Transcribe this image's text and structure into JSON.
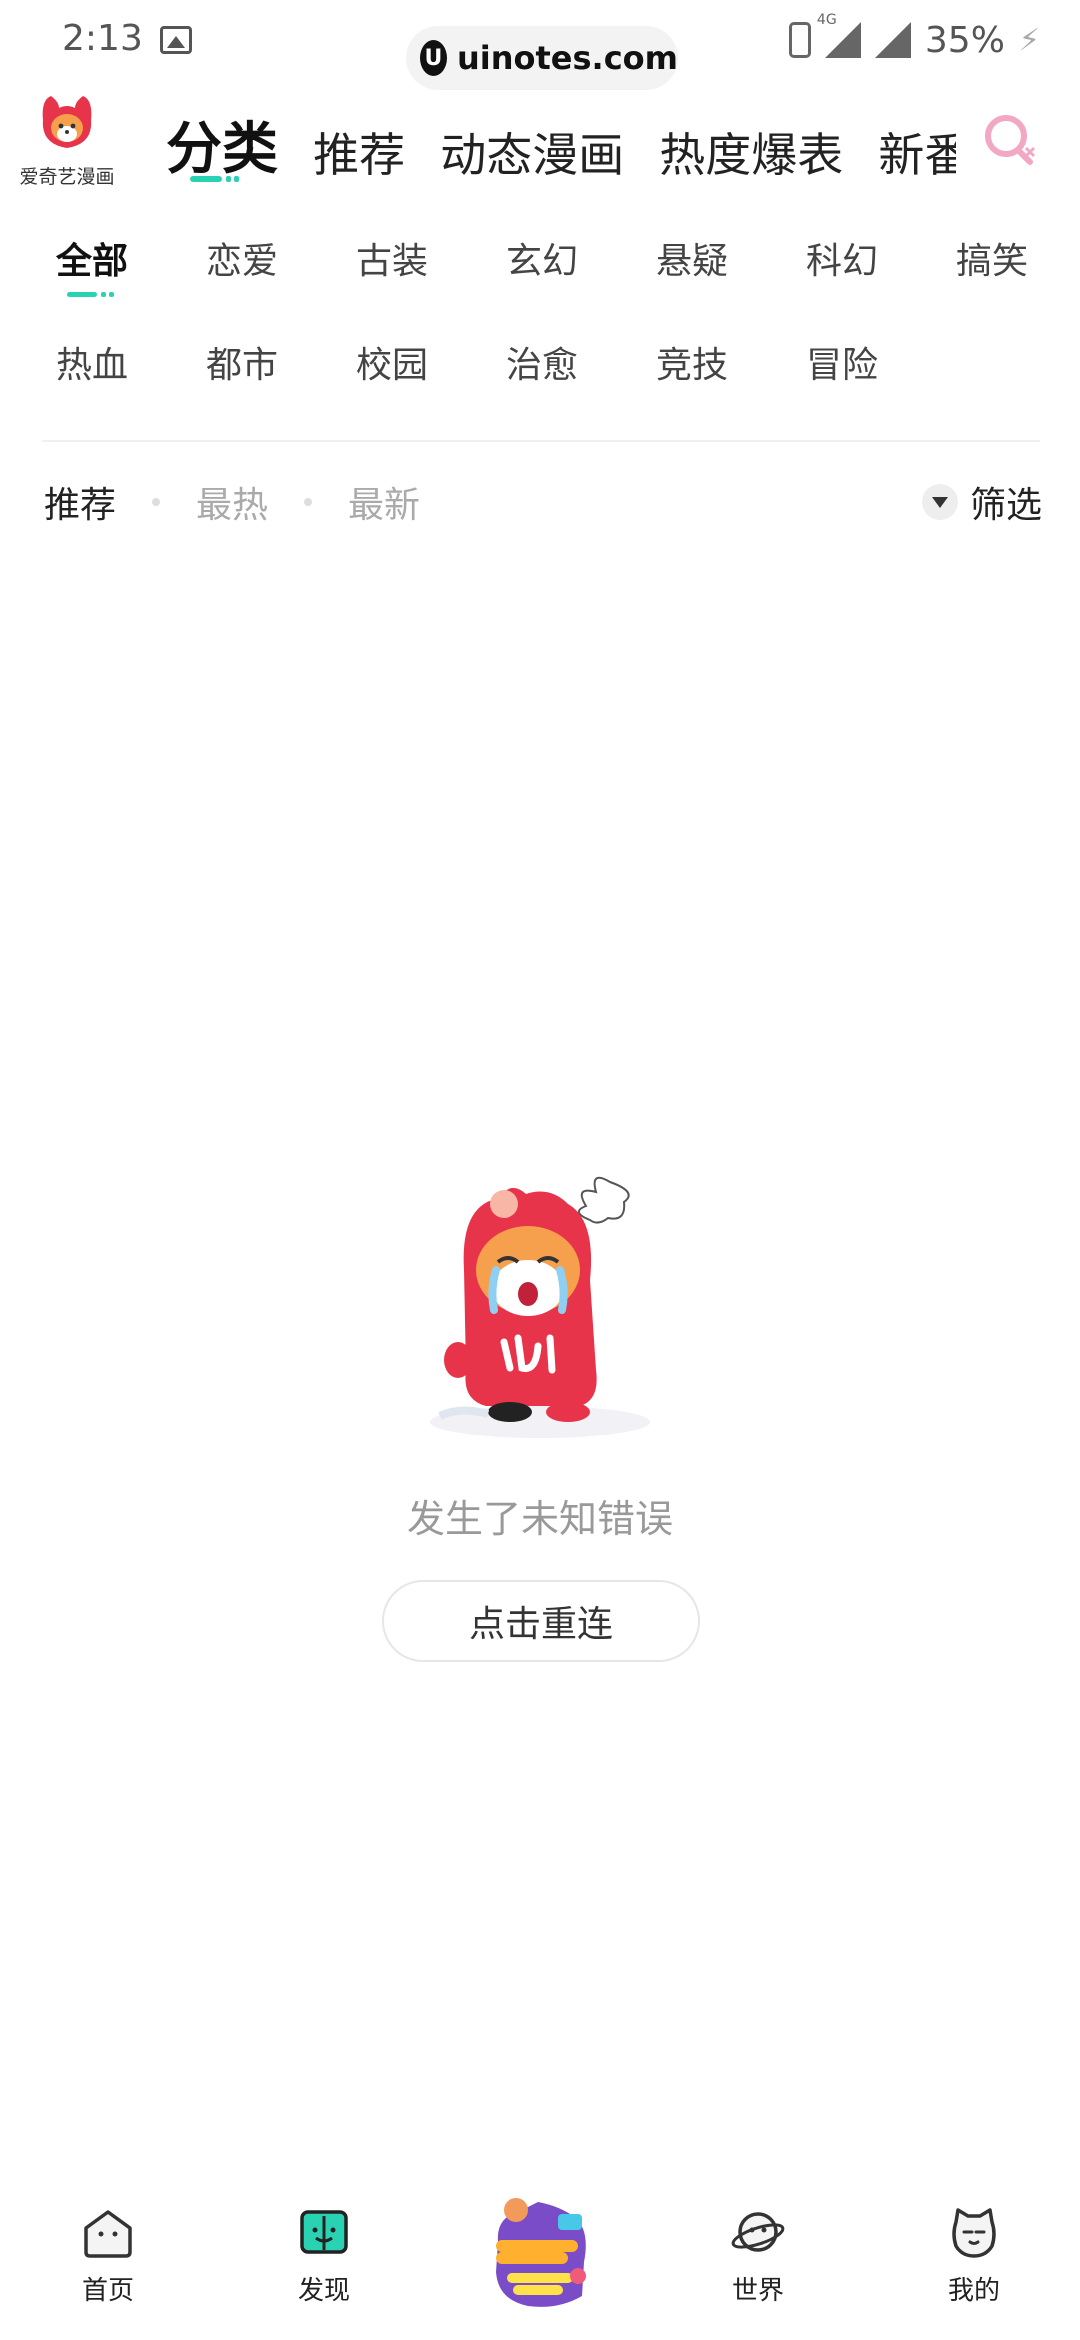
{
  "status_bar": {
    "time": "2:13",
    "watermark": "uinotes.com",
    "network": "4G",
    "battery": "35%"
  },
  "brand": {
    "label": "爱奇艺漫画"
  },
  "top_tabs": [
    "分类",
    "推荐",
    "动态漫画",
    "热度爆表",
    "新番大"
  ],
  "active_top_tab": "分类",
  "categories": {
    "row1": [
      "全部",
      "恋爱",
      "古装",
      "玄幻",
      "悬疑",
      "科幻",
      "搞笑"
    ],
    "row2": [
      "热血",
      "都市",
      "校园",
      "治愈",
      "竞技",
      "冒险"
    ]
  },
  "active_category": "全部",
  "sort": {
    "items": [
      "推荐",
      "最热",
      "最新"
    ],
    "active": "推荐",
    "filter_label": "筛选"
  },
  "empty_state": {
    "message": "发生了未知错误",
    "retry_label": "点击重连"
  },
  "bottom_nav": {
    "home": "首页",
    "discover": "发现",
    "world": "世界",
    "mine": "我的"
  },
  "colors": {
    "accent": "#2ad2b4",
    "brand_red": "#e8344a",
    "search_pink": "#f2a8c4"
  }
}
